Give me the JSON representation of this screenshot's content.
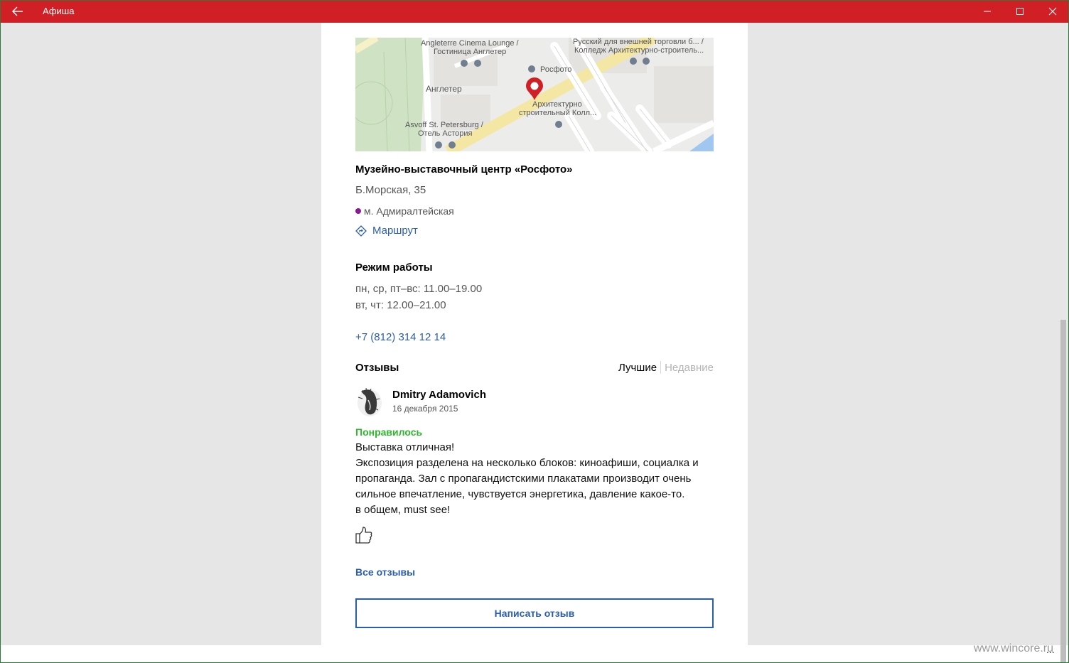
{
  "app": {
    "title": "Афиша"
  },
  "map": {
    "labels": {
      "angleterre_lounge": "Angleterre Cinema Lounge /",
      "angleterre_hotel": "Гостиница Англетер",
      "russian_college": "Русский для внешней торговли б... /",
      "arch_college_top": "Колледж Архитектурно-строитель...",
      "rosfoto": "Росфото",
      "angleterre": "Англетер",
      "arch_college_1": "Архитектурно",
      "arch_college_2": "строительный Колл...",
      "asvoff_1": "Asvoff St. Petersburg /",
      "asvoff_2": "Отель Астория"
    }
  },
  "place": {
    "name": "Музейно-выставочный центр «Росфото»",
    "address": "Б.Морская, 35",
    "metro": "м. Адмиралтейская",
    "route_label": "Маршрут"
  },
  "hours": {
    "title": "Режим работы",
    "lines": [
      "пн, ср, пт–вс: 11.00–19.00",
      "вт, чт: 12.00–21.00"
    ]
  },
  "phone": "+7 (812) 314 12 14",
  "reviews": {
    "title": "Отзывы",
    "tabs": [
      "Лучшие",
      "Недавние"
    ],
    "items": [
      {
        "author": "Dmitry Adamovich",
        "date": "16 декабря 2015",
        "verdict": "Понравилось",
        "lines": [
          "Выставка отличная!",
          "Экспозиция разделена на несколько блоков: киноафиши, социалка и",
          "пропаганда. Зал с пропагандистскими плакатами производит очень",
          "сильное впечатление, чувствуется энергетика, давление какое-то.",
          "в общем, must see!"
        ]
      }
    ],
    "all_label": "Все отзывы",
    "write_label": "Написать отзыв"
  },
  "watermark": "www.wincore.ru",
  "more_dots": "...",
  "colors": {
    "titlebar": "#d11f26",
    "link": "#2a5db0",
    "positive": "#2eb82e",
    "metro_line": "#8a1a8f"
  }
}
